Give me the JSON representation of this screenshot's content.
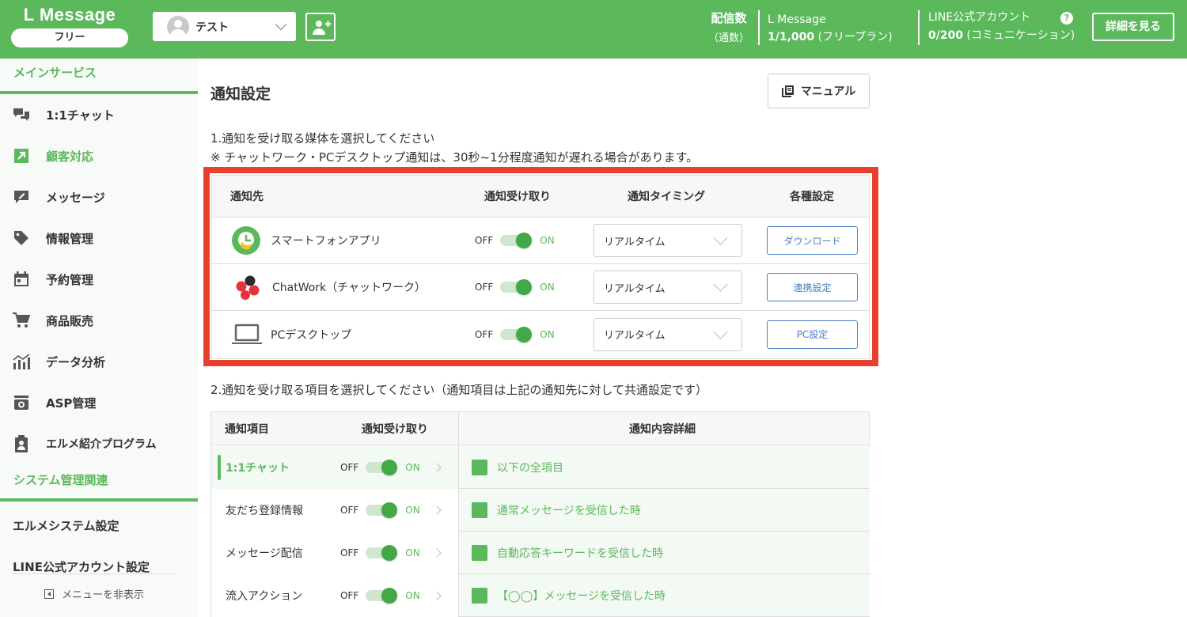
{
  "header": {
    "brand": "L Message",
    "plan": "フリー",
    "account": "テスト",
    "delivery_label": "配信数",
    "delivery_sub": "（通数）",
    "lmessage_label": "L Message",
    "lmessage_count": "1/1,000",
    "lmessage_plan": " (フリープラン)",
    "line_label": "LINE公式アカウント",
    "line_count": "0/200",
    "line_plan": " (コミュニケーション)",
    "help": "?",
    "details_button": "詳細を見る"
  },
  "sidebar": {
    "main_section": "メインサービス",
    "items": [
      {
        "label": "1:1チャット",
        "icon": "chat-icon"
      },
      {
        "label": "顧客対応",
        "icon": "arrow-up-right-icon",
        "active": true
      },
      {
        "label": "メッセージ",
        "icon": "message-edit-icon"
      },
      {
        "label": "情報管理",
        "icon": "tag-icon"
      },
      {
        "label": "予約管理",
        "icon": "calendar-icon"
      },
      {
        "label": "商品販売",
        "icon": "cart-icon"
      },
      {
        "label": "データ分析",
        "icon": "chart-icon"
      },
      {
        "label": "ASP管理",
        "icon": "asp-icon"
      },
      {
        "label": "エルメ紹介プログラム",
        "icon": "clipboard-user-icon"
      }
    ],
    "system_section": "システム管理関連",
    "system_items": [
      "エルメシステム設定",
      "LINE公式アカウント設定"
    ],
    "hide_menu": "メニューを非表示"
  },
  "main": {
    "title": "通知設定",
    "manual_button": "マニュアル",
    "step1": "1.通知を受け取る媒体を選択してください",
    "step1_note": "※ チャットワーク・PCデスクトップ通知は、30秒~1分程度通知が遅れる場合があります。",
    "dest_table": {
      "headers": [
        "通知先",
        "通知受け取り",
        "通知タイミング",
        "各種設定"
      ],
      "rows": [
        {
          "name": "スマートフォンアプリ",
          "icon": "smartphone-app-icon",
          "timing": "リアルタイム",
          "button": "ダウンロード"
        },
        {
          "name": "ChatWork（チャットワーク）",
          "icon": "chatwork-icon",
          "timing": "リアルタイム",
          "button": "連携設定"
        },
        {
          "name": "PCデスクトップ",
          "icon": "laptop-icon",
          "timing": "リアルタイム",
          "button": "PC設定"
        }
      ]
    },
    "toggle_off": "OFF",
    "toggle_on": "ON",
    "step2": "2.通知を受け取る項目を選択してください（通知項目は上記の通知先に対して共通設定です）",
    "item_table": {
      "headers": [
        "通知項目",
        "通知受け取り",
        "通知内容詳細"
      ],
      "rows": [
        {
          "item": "1:1チャット",
          "detail": "以下の全項目",
          "selected": true
        },
        {
          "item": "友だち登録情報",
          "detail": "通常メッセージを受信した時"
        },
        {
          "item": "メッセージ配信",
          "detail": "自動応答キーワードを受信した時"
        },
        {
          "item": "流入アクション",
          "detail": "【◯◯】メッセージを受信した時"
        }
      ]
    }
  }
}
